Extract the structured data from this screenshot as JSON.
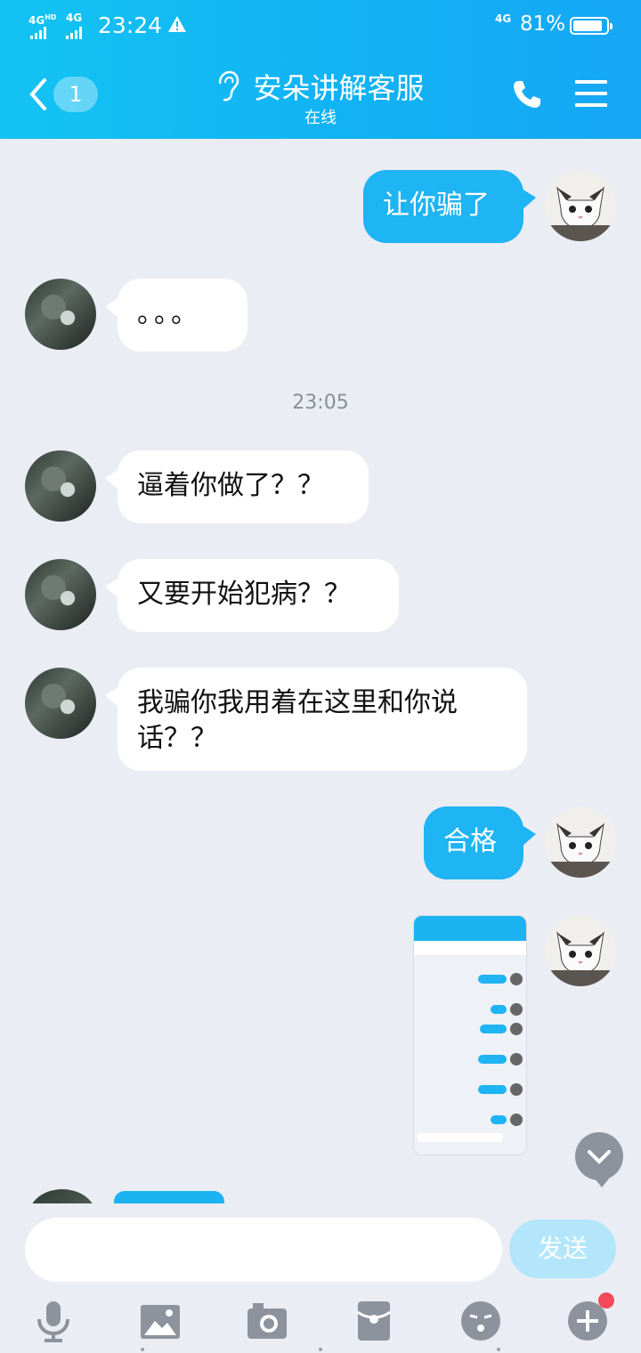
{
  "status_bar": {
    "signal1": "4G",
    "signal1_sup": "HD",
    "signal2": "4G",
    "time": "23:24",
    "network": "4G",
    "battery": "81%",
    "battery_level": 0.81
  },
  "header": {
    "back_count": "1",
    "title": "安朵讲解客服",
    "subtitle": "在线"
  },
  "messages": [
    {
      "sender": "me",
      "text": "让你骗了"
    },
    {
      "sender": "them",
      "text": "。。。"
    },
    {
      "type": "timestamp",
      "text": "23:05"
    },
    {
      "sender": "them",
      "text": "逼着你做了？？"
    },
    {
      "sender": "them",
      "text": "又要开始犯病？？"
    },
    {
      "sender": "them",
      "text": "我骗你我用着在这里和你说话？？"
    },
    {
      "sender": "me",
      "text": "合格"
    },
    {
      "sender": "me",
      "type": "image"
    }
  ],
  "input": {
    "placeholder": "",
    "send_label": "发送"
  },
  "toolbar": [
    "mic-icon",
    "image-icon",
    "camera-icon",
    "red-packet-icon",
    "emoji-icon",
    "plus-icon"
  ],
  "colors": {
    "header": "#12b2f4",
    "outgoing_bubble": "#1fb4f3",
    "incoming_bubble": "#ffffff",
    "background": "#eaedf3",
    "send_disabled": "#b3e6fb"
  }
}
